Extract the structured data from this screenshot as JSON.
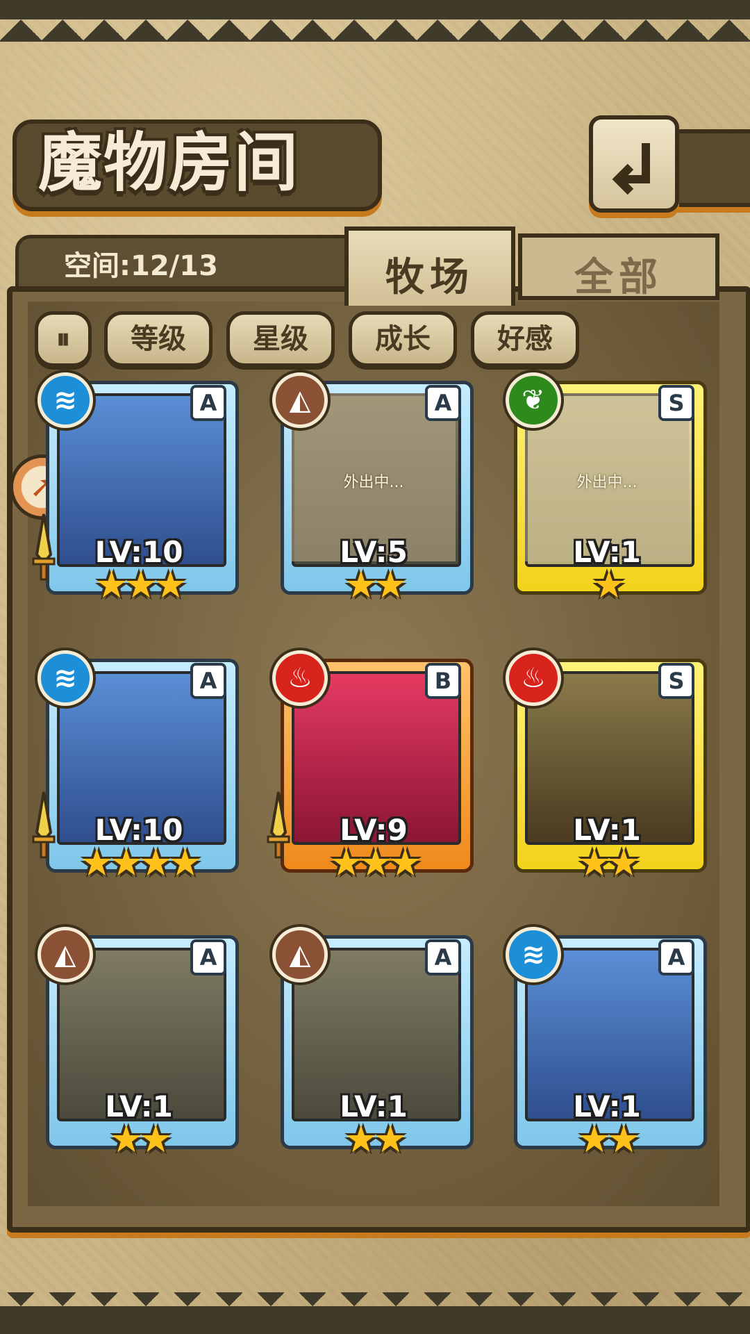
{
  "header": {
    "title": "魔物房间",
    "back_icon": "back-arrow-icon"
  },
  "capacity": {
    "label": "空间:12/13"
  },
  "tabs": [
    {
      "label": "牧场",
      "active": true
    },
    {
      "label": "全部",
      "active": false
    }
  ],
  "filters": {
    "sort_icon": "sort-toggle-icon",
    "items": [
      "等级",
      "星级",
      "成长",
      "好感"
    ]
  },
  "monsters": [
    {
      "element": "water",
      "grade": "A",
      "level": "LV:10",
      "stars": 3,
      "frame": "blue",
      "away": false,
      "sword": true
    },
    {
      "element": "earth",
      "grade": "A",
      "level": "LV:5",
      "stars": 2,
      "frame": "blue",
      "away": true,
      "away_text": "外出中...",
      "sword": false
    },
    {
      "element": "wood",
      "grade": "S",
      "level": "LV:1",
      "stars": 1,
      "frame": "yellow",
      "away": true,
      "away_text": "外出中...",
      "sword": false
    },
    {
      "element": "water",
      "grade": "A",
      "level": "LV:10",
      "stars": 4,
      "frame": "blue",
      "away": false,
      "sword": true
    },
    {
      "element": "fire",
      "grade": "B",
      "level": "LV:9",
      "stars": 3,
      "frame": "orange",
      "away": false,
      "sword": true
    },
    {
      "element": "fire",
      "grade": "S",
      "level": "LV:1",
      "stars": 2,
      "frame": "yellow",
      "away": false,
      "sword": false
    },
    {
      "element": "earth",
      "grade": "A",
      "level": "LV:1",
      "stars": 2,
      "frame": "blue",
      "away": false,
      "sword": false
    },
    {
      "element": "earth",
      "grade": "A",
      "level": "LV:1",
      "stars": 2,
      "frame": "blue",
      "away": false,
      "sword": false
    },
    {
      "element": "water",
      "grade": "A",
      "level": "LV:1",
      "stars": 2,
      "frame": "blue",
      "away": false,
      "sword": false
    }
  ],
  "colors": {
    "accent": "#c77a1e",
    "dark": "#3b2f1a",
    "water": "#1d8fd8",
    "earth": "#8a5134",
    "wood": "#2f8a1e",
    "fire": "#d8231d"
  }
}
